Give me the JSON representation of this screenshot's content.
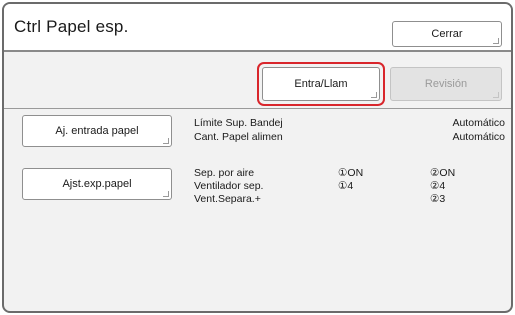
{
  "header": {
    "title": "Ctrl Papel esp.",
    "close_label": "Cerrar"
  },
  "toolbar": {
    "entry_label": "Entra/Llam",
    "review_label": "Revisión"
  },
  "section_feed": {
    "button_label": "Aj. entrada papel",
    "rows": [
      {
        "label": "Límite Sup. Bandej",
        "value": "Automático"
      },
      {
        "label": "Cant. Papel alimen",
        "value": "Automático"
      }
    ]
  },
  "section_eject": {
    "button_label": "Ajst.exp.papel",
    "rows": [
      {
        "label": "Sep. por aire",
        "v1": "①ON",
        "v2": "②ON"
      },
      {
        "label": "Ventilador sep.",
        "v1": "①4",
        "v2": "②4"
      },
      {
        "label": "Vent.Separa.+",
        "v1": "",
        "v2": "②3"
      }
    ]
  },
  "colors": {
    "highlight": "#d9262c",
    "panel": "#f2f2f2"
  }
}
